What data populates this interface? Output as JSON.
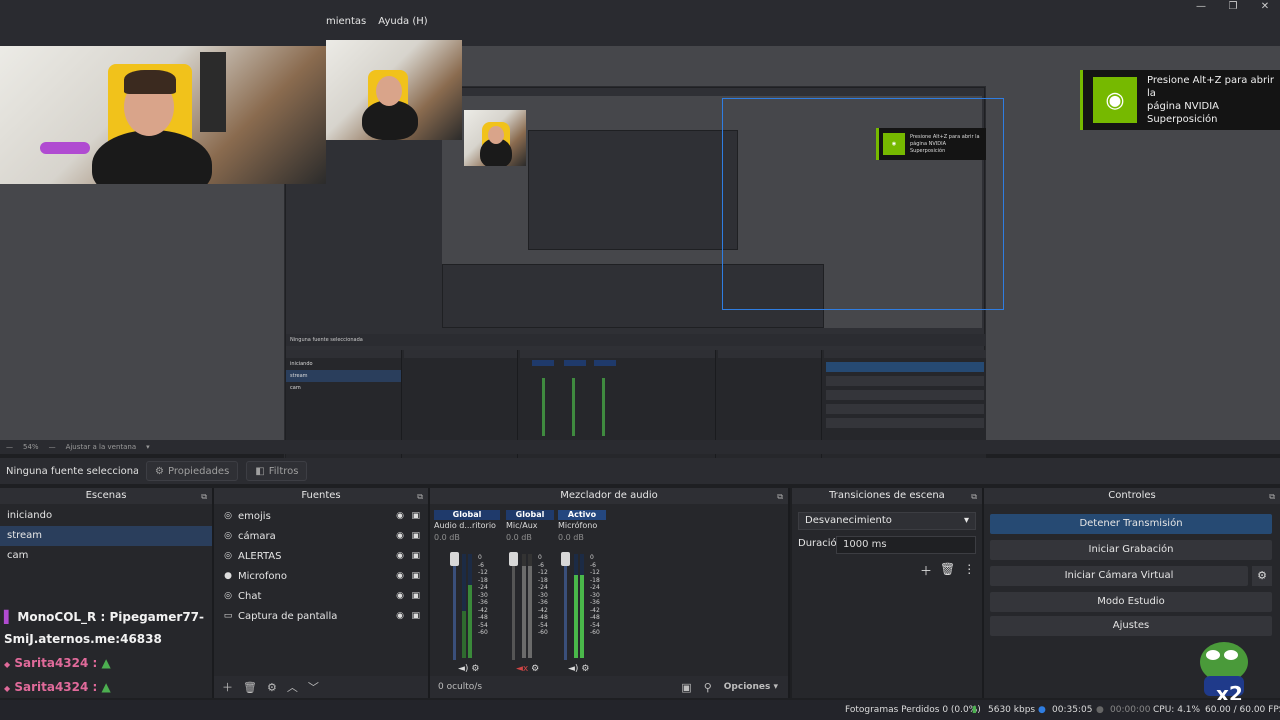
{
  "menu": {
    "tools_partial": "mientas",
    "help": "Ayuda (H)"
  },
  "preview": {
    "zoom": "54%",
    "fit": "Ajustar a la ventana",
    "nvidia": {
      "line1": "Presione Alt+Z para abrir la",
      "line2": "página NVIDIA",
      "line3": "Superposición"
    }
  },
  "source_bar": {
    "no_source": "Ninguna fuente seleccionada",
    "properties": "Propiedades",
    "filters": "Filtros"
  },
  "scenes": {
    "title": "Escenas",
    "items": [
      "iniciando",
      "stream",
      "cam"
    ],
    "active_index": 1
  },
  "sources": {
    "title": "Fuentes",
    "items": [
      "emojis",
      "cámara",
      "ALERTAS",
      "Microfono",
      "Chat",
      "Captura de pantalla"
    ]
  },
  "mixer": {
    "title": "Mezclador de audio",
    "channels": [
      {
        "scope": "Global",
        "name": "Audio d...ritorio",
        "db": "0.0 dB"
      },
      {
        "scope": "Global",
        "name": "Mic/Aux",
        "db": "0.0 dB"
      },
      {
        "scope": "Activo",
        "name": "Micrófono",
        "db": "0.0 dB"
      }
    ],
    "scale": [
      "0",
      "-6",
      "-12",
      "-18",
      "-24",
      "-30",
      "-36",
      "-42",
      "-48",
      "-54",
      "-60"
    ],
    "hidden": "0 oculto/s",
    "options": "Opciones"
  },
  "transitions": {
    "title": "Transiciones de escena",
    "selected": "Desvanecimiento",
    "duration_label": "Duración",
    "duration_value": "1000 ms"
  },
  "controls": {
    "title": "Controles",
    "stop_stream": "Detener Transmisión",
    "start_recording": "Iniciar Grabación",
    "start_virtual_cam": "Iniciar Cámara Virtual",
    "studio_mode": "Modo Estudio",
    "settings": "Ajustes"
  },
  "status": {
    "dropped": "Fotogramas Perdidos 0 (0.0%)",
    "bitrate": "5630 kbps",
    "stream_time": "00:35:05",
    "rec_time": "00:00:00",
    "cpu": "CPU: 4.1%",
    "fps": "60.00 / 60.00 FPS"
  },
  "chat": {
    "line1": "MonoCOL_R : Pipegamer77-",
    "line2": "SmiJ.aternos.me:46838",
    "user1": "Sarita4324 :",
    "user2": "Sarita4324 :"
  },
  "overlay_badge": "x2",
  "colors": {
    "accent": "#2a3e5c",
    "nvidia_green": "#76b900",
    "chat_pink": "#e06a9a"
  }
}
